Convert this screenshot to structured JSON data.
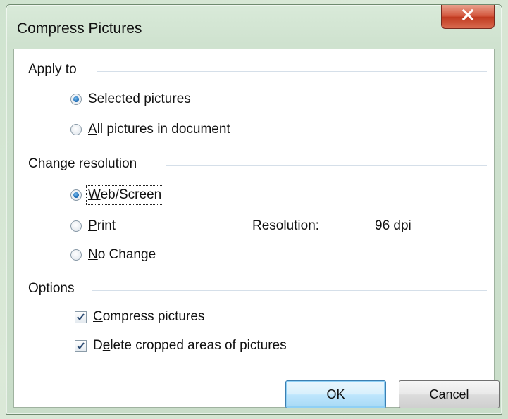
{
  "dialog": {
    "title": "Compress Pictures",
    "close_glyph": "×"
  },
  "apply_to": {
    "heading": "Apply to",
    "options": [
      {
        "prefix": "",
        "accel": "S",
        "rest": "elected pictures",
        "selected": true
      },
      {
        "prefix": "",
        "accel": "A",
        "rest": "ll pictures in document",
        "selected": false
      }
    ]
  },
  "resolution": {
    "heading": "Change resolution",
    "options": [
      {
        "prefix": "",
        "accel": "W",
        "rest": "eb/Screen",
        "selected": true
      },
      {
        "prefix": "",
        "accel": "P",
        "rest": "rint",
        "selected": false
      },
      {
        "prefix": "",
        "accel": "N",
        "rest": "o Change",
        "selected": false
      }
    ],
    "resolution_label": "Resolution:",
    "resolution_value": "96 dpi"
  },
  "options": {
    "heading": "Options",
    "checks": [
      {
        "prefix": "",
        "accel": "C",
        "rest": "ompress pictures",
        "checked": true
      },
      {
        "prefix": "D",
        "accel": "e",
        "rest": "lete cropped areas of pictures",
        "checked": true
      }
    ]
  },
  "buttons": {
    "ok": "OK",
    "cancel": "Cancel"
  },
  "icons": {
    "close": "close-icon",
    "check": "checkmark-icon"
  },
  "colors": {
    "close_button": "#d2543a",
    "default_button_border": "#3c7fb1",
    "radio_dot": "#1f6fb8"
  }
}
